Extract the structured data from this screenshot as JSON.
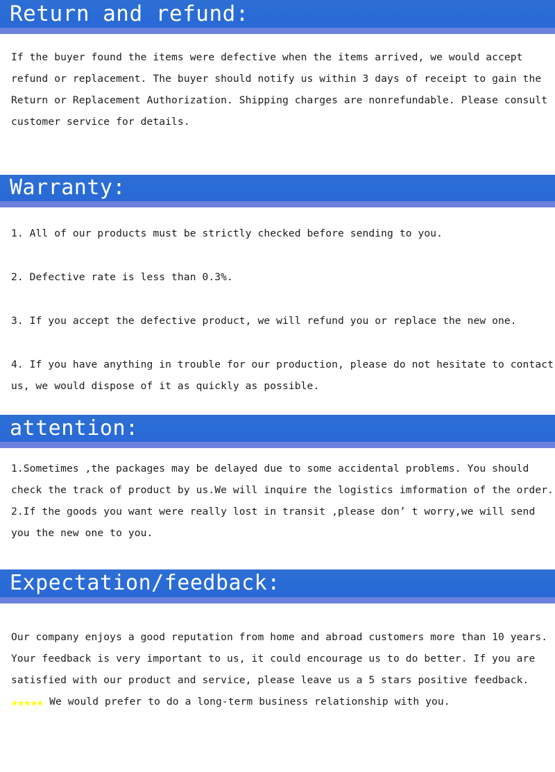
{
  "document": {
    "title": "Return and refund / Warranty / attention / Expectation-feedback policy",
    "accent_blue": "#2a6cd6",
    "accent_blue_strip": "#6b81dd",
    "star_color": "#ffff00",
    "background": "#ffffff",
    "text_color": "#1a1a1a"
  },
  "sections": {
    "return": {
      "heading": "Return and refund:",
      "paragraph": "If the buyer found the items were defective when the items arrived, we would accept refund or replacement. The buyer should notify us within 3 days of receipt to gain the Return or Replacement Authorization. Shipping charges are nonrefundable. Please consult customer service for details."
    },
    "warranty": {
      "heading": "Warranty:",
      "items": [
        "1. All of our products must be strictly checked before sending to you.",
        "2. Defective rate is less than 0.3%.",
        "3. If you accept the defective product, we will refund you or replace the new one.",
        "4. If you have anything in trouble for our production, please do not hesitate to contact us, we would dispose of it as quickly as possible."
      ]
    },
    "attention": {
      "heading": "attention:",
      "items": [
        "1.Sometimes ,the packages may be delayed due to some accidental problems. You should check the track of product by us.We will inquire the logistics imformation of the order.",
        "2.If the goods you want were really lost in transit ,please don’ t worry,we will send you the new one to you."
      ]
    },
    "expectation": {
      "heading": "Expectation/feedback:",
      "text_before_stars": "Our company enjoys a good reputation from home and abroad customers more than 10 years. Your feedback is very important to us, it could encourage us to do better. If you are satisfied with our product and service, please leave us a 5 stars positive feedback.",
      "stars": "★★★★★",
      "star_count": 5,
      "text_after_stars": " We would prefer to do a long-term business relationship with you."
    }
  }
}
